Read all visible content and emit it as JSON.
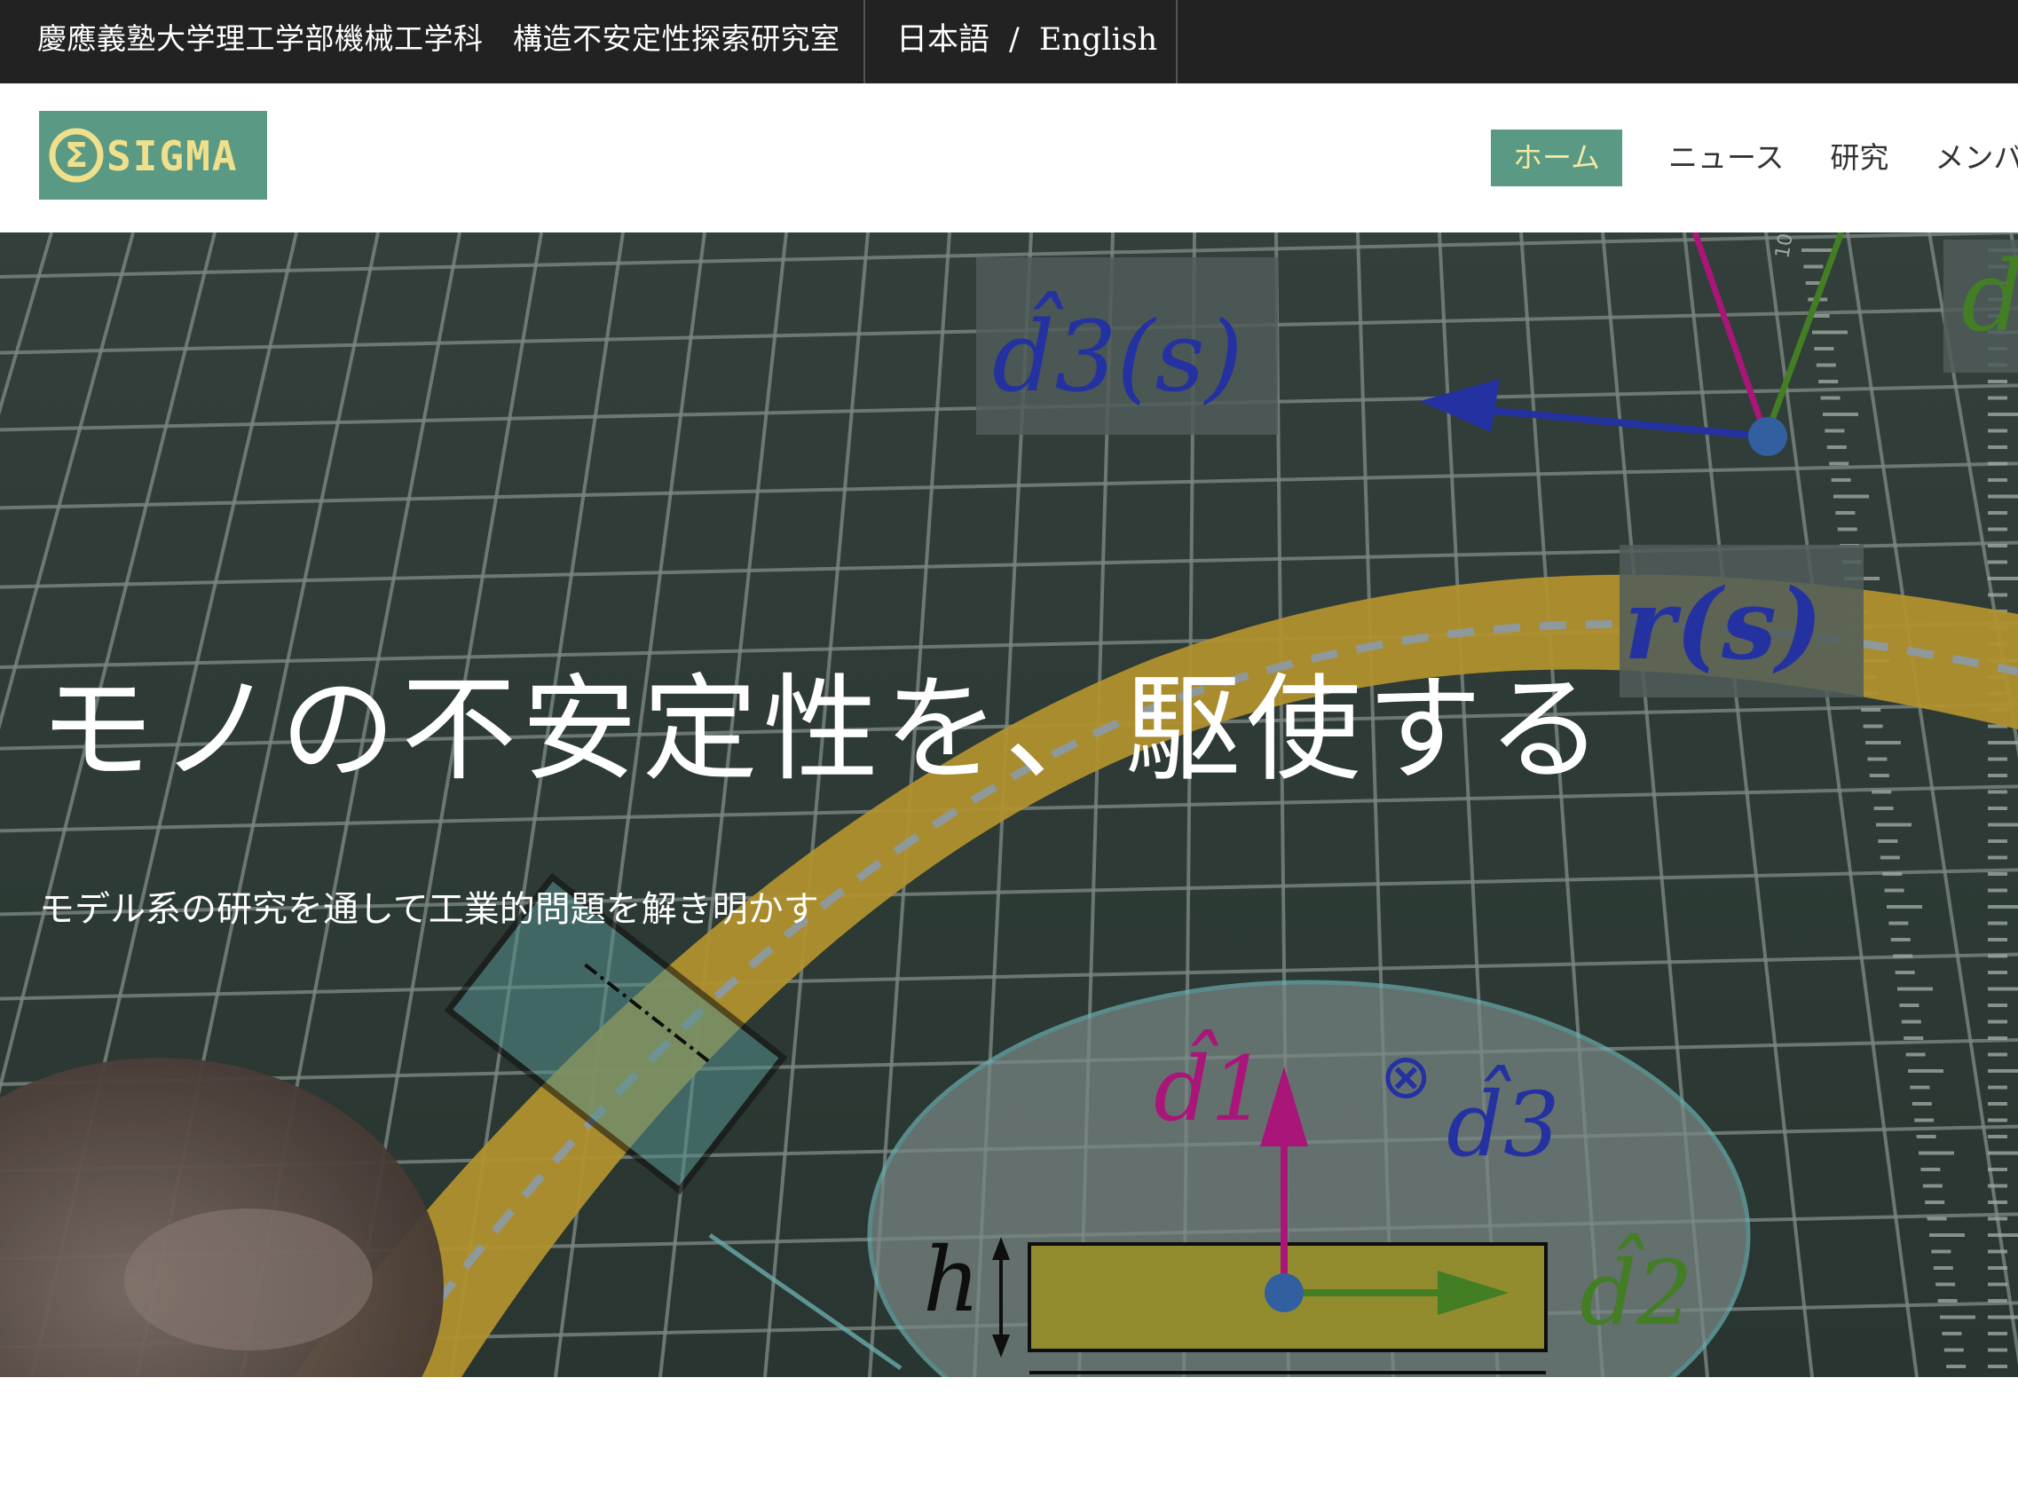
{
  "topbar": {
    "lab_title": "慶應義塾大学理工学部機械工学科　構造不安定性探索研究室",
    "lang_ja": "日本語",
    "lang_separator": "/",
    "lang_en": "English"
  },
  "logo": {
    "text": "SIGMA",
    "symbol": "Σ",
    "colors": {
      "background": "#5a9a84",
      "foreground": "#f0e08c"
    }
  },
  "nav": {
    "items": [
      {
        "label": "ホーム",
        "active": true
      },
      {
        "label": "ニュース",
        "active": false
      },
      {
        "label": "研究",
        "active": false
      },
      {
        "label": "メンバ",
        "active": false
      }
    ]
  },
  "hero": {
    "headline": "モノの不安定性を、駆使する",
    "subline": "モデル系の研究を通して工業的問題を解き明かす",
    "annotations": {
      "d3s": "d̂3(s)",
      "rs": "r(s)",
      "d1": "d̂1",
      "d2": "d̂2",
      "d3": "d̂3",
      "h": "h",
      "otimes": "⊗",
      "partial_d": "d",
      "ruler_mark": "10"
    }
  },
  "colors": {
    "accent": "#5a9a84",
    "accent_text": "#f3e7a2",
    "topbar_bg": "#222222",
    "ribbon": "#d8b23a",
    "magenta": "#c2188a",
    "blue": "#2a39b8",
    "green": "#4d8f2a"
  }
}
